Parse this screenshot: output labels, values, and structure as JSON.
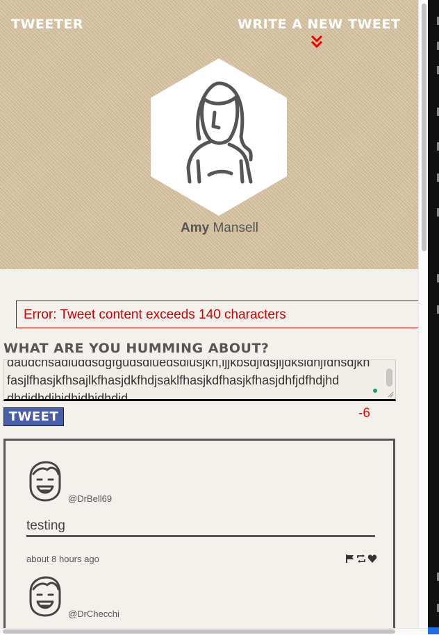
{
  "app": {
    "brand": "TWEETER",
    "compose_link": "WRITE A NEW TWEET",
    "profile": {
      "first_name": "Amy",
      "last_name": "Mansell"
    }
  },
  "compose": {
    "error": "Error: Tweet content exceeds 140 characters",
    "heading": "WHAT ARE YOU HUMMING ABOUT?",
    "text_line1": "daudchsadiuddsdgfgudsdiuedsdiusjkh,ljjkbsdjfdsjljdksldhjfdnsdjkh",
    "text_line2": "fasjlfhasjkfhsajlkfhasjdkfhdjsaklfhasjkdfhasjkfhasjdhfjdfhdjhd",
    "text_line3": "dhdjdhdjhjdhjdhjdhdjd",
    "button_label": "TWEET",
    "counter": "-6"
  },
  "feed": [
    {
      "handle": "@DrBell69",
      "content": "testing",
      "time": "about 8 hours ago"
    },
    {
      "handle": "@DrChecchi",
      "content": "",
      "time": ""
    }
  ],
  "icons": {
    "flag": "flag-icon",
    "retweet": "retweet-icon",
    "like": "heart-icon",
    "chevrons": "double-chevron-down-icon"
  },
  "colors": {
    "accent": "#e00000",
    "button": "#4a5ea8",
    "error": "#cc0000"
  }
}
